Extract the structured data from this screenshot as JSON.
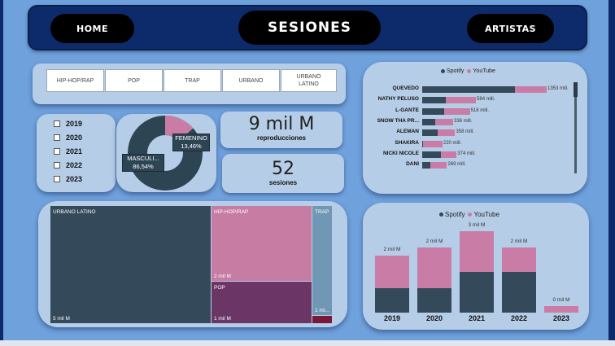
{
  "header": {
    "home_label": "HOME",
    "title": "SESIONES",
    "artists_label": "ARTISTAS"
  },
  "genre_filters": [
    "HIP-HOP/RAP",
    "POP",
    "TRAP",
    "URBANO",
    "URBANO LATINO"
  ],
  "year_filters": [
    "2019",
    "2020",
    "2021",
    "2022",
    "2023"
  ],
  "gender_donut": {
    "masculine_label": "MASCULI...",
    "masculine_pct": "86,54%",
    "feminine_label": "FEMENINO",
    "feminine_pct": "13,46%",
    "masculine_value": 86.54,
    "feminine_value": 13.46,
    "colors": {
      "masculine": "#2d4453",
      "feminine": "#c97da6"
    }
  },
  "kpis": {
    "reproductions_value": "9 mil M",
    "reproductions_label": "reproducciones",
    "sessions_value": "52",
    "sessions_label": "sesiones"
  },
  "treemap": [
    {
      "name": "URBANO LATINO",
      "value_label": "5 mil M",
      "color": "#34495a"
    },
    {
      "name": "HIP-HOP/RAP",
      "value_label": "2 mil M",
      "color": "#c77ca3"
    },
    {
      "name": "POP",
      "value_label": "1 mil M",
      "color": "#6b3565"
    },
    {
      "name": "TRAP",
      "value_label": "1 mi...",
      "color": "#7098b4"
    },
    {
      "name": "",
      "value_label": "",
      "color": "#7a1838"
    }
  ],
  "colors": {
    "spotify": "#34495a",
    "youtube": "#c97da6",
    "background": "#6fa1dc",
    "header": "#0d2a6a",
    "panel": "#b5cde6"
  },
  "chart_data": [
    {
      "type": "bar",
      "orientation": "horizontal",
      "stacked": true,
      "legend": [
        "Spotify",
        "YouTube"
      ],
      "legend_position": "top",
      "categories": [
        "QUEVEDO",
        "NATHY PELUSO",
        "L-GANTE",
        "SNOW THA PR...",
        "ALEMAN",
        "SHAKIRA",
        "NICKI NICOLE",
        "DANI"
      ],
      "total_labels": [
        "1353 mill.",
        "584 mill.",
        "518 mill.",
        "336 mill.",
        "358 mill.",
        "220 mill.",
        "374 mill.",
        "269 mill."
      ],
      "totals": [
        1353,
        584,
        518,
        336,
        358,
        220,
        374,
        269
      ],
      "series": [
        {
          "name": "Spotify",
          "values": [
            1010,
            260,
            240,
            140,
            170,
            10,
            200,
            90
          ]
        },
        {
          "name": "YouTube",
          "values": [
            343,
            324,
            278,
            196,
            188,
            210,
            174,
            179
          ]
        }
      ]
    },
    {
      "type": "bar",
      "stacked": true,
      "legend": [
        "Spotify",
        "YouTube"
      ],
      "legend_position": "top",
      "categories": [
        "2019",
        "2020",
        "2021",
        "2022",
        "2023"
      ],
      "total_labels": [
        "2 mil M",
        "2 mil M",
        "3 mil M",
        "2 mil M",
        "0 mil M"
      ],
      "series": [
        {
          "name": "Spotify",
          "values": [
            0.9,
            0.9,
            1.5,
            1.5,
            0.0
          ]
        },
        {
          "name": "YouTube",
          "values": [
            1.2,
            1.5,
            1.5,
            0.9,
            0.25
          ]
        }
      ]
    }
  ]
}
